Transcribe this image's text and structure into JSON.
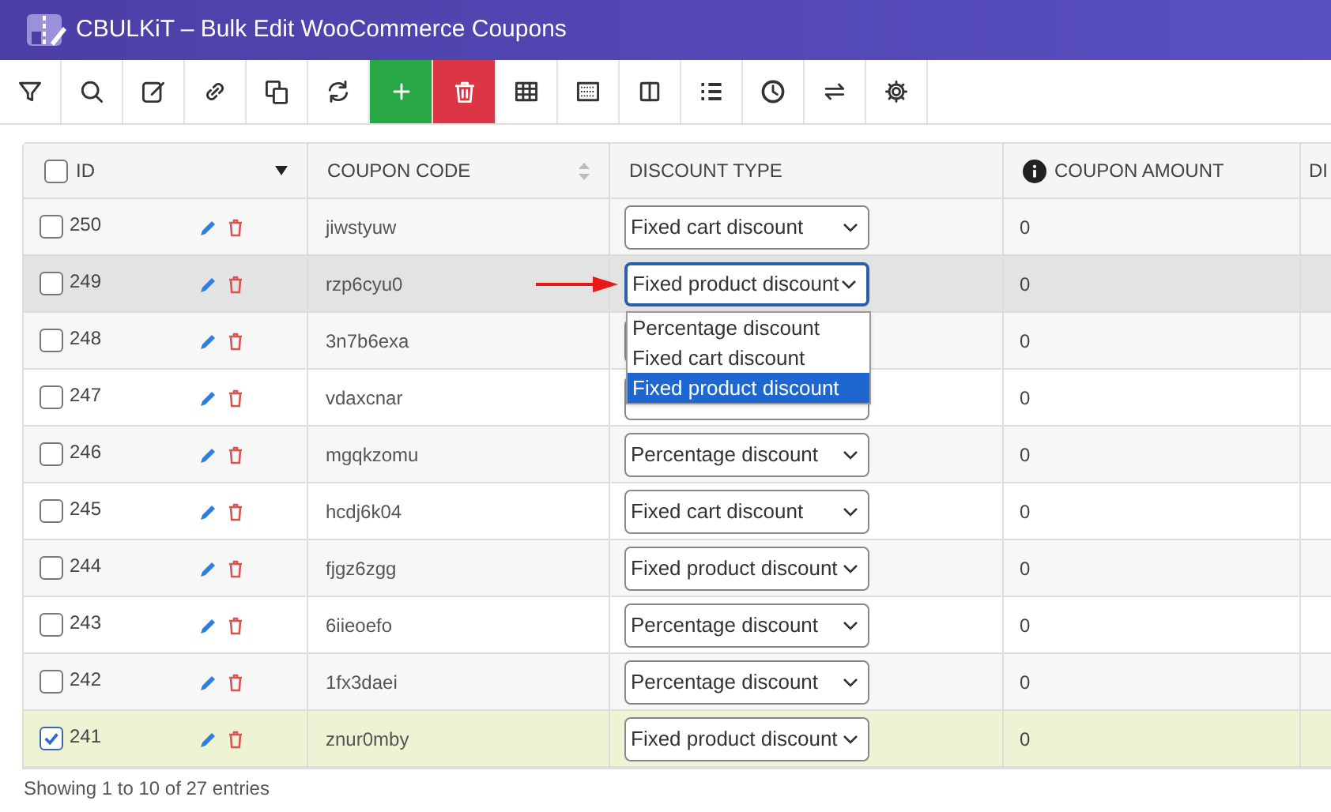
{
  "window": {
    "title": "CBULKiT – Bulk Edit WooCommerce Coupons"
  },
  "toolbar": [
    {
      "kind": "filter"
    },
    {
      "kind": "search"
    },
    {
      "kind": "edit"
    },
    {
      "kind": "link"
    },
    {
      "kind": "copy"
    },
    {
      "kind": "refresh"
    },
    {
      "kind": "add"
    },
    {
      "kind": "delete"
    },
    {
      "kind": "table"
    },
    {
      "kind": "grid"
    },
    {
      "kind": "columns"
    },
    {
      "kind": "list"
    },
    {
      "kind": "history"
    },
    {
      "kind": "swap"
    },
    {
      "kind": "settings"
    }
  ],
  "table": {
    "select_all": {
      "checked": false
    },
    "columns": [
      "ID",
      "COUPON CODE",
      "DISCOUNT TYPE",
      "COUPON AMOUNT",
      "DI"
    ],
    "rows": [
      {
        "id": "250",
        "code": "jiwstyuw",
        "discount_type": "Fixed cart discount",
        "amount": "0",
        "checked": false,
        "hovered": false
      },
      {
        "id": "249",
        "code": "rzp6cyu0",
        "discount_type": "Fixed product discount",
        "amount": "0",
        "checked": false,
        "hovered": true,
        "open": true
      },
      {
        "id": "248",
        "code": "3n7b6exa",
        "amount": "0",
        "checked": false,
        "hovered": false
      },
      {
        "id": "247",
        "code": "vdaxcnar",
        "amount": "0",
        "checked": false,
        "hovered": false
      },
      {
        "id": "246",
        "code": "mgqkzomu",
        "discount_type": "Percentage discount",
        "amount": "0",
        "checked": false,
        "hovered": false
      },
      {
        "id": "245",
        "code": "hcdj6k04",
        "discount_type": "Fixed cart discount",
        "amount": "0",
        "checked": false,
        "hovered": false
      },
      {
        "id": "244",
        "code": "fjgz6zgg",
        "discount_type": "Fixed product discount",
        "amount": "0",
        "checked": false,
        "hovered": false
      },
      {
        "id": "243",
        "code": "6iieoefo",
        "discount_type": "Percentage discount",
        "amount": "0",
        "checked": false,
        "hovered": false
      },
      {
        "id": "242",
        "code": "1fx3daei",
        "discount_type": "Percentage discount",
        "amount": "0",
        "checked": false,
        "hovered": false
      },
      {
        "id": "241",
        "code": "znur0mby",
        "discount_type": "Fixed product discount",
        "amount": "0",
        "checked": true,
        "hovered": false
      }
    ]
  },
  "dropdown": {
    "options": [
      {
        "label": "Percentage discount",
        "selected": false
      },
      {
        "label": "Fixed cart discount",
        "selected": false
      },
      {
        "label": "Fixed product discount",
        "selected": true
      }
    ]
  },
  "footer": {
    "info": "Showing 1 to 10 of 27 entries"
  }
}
